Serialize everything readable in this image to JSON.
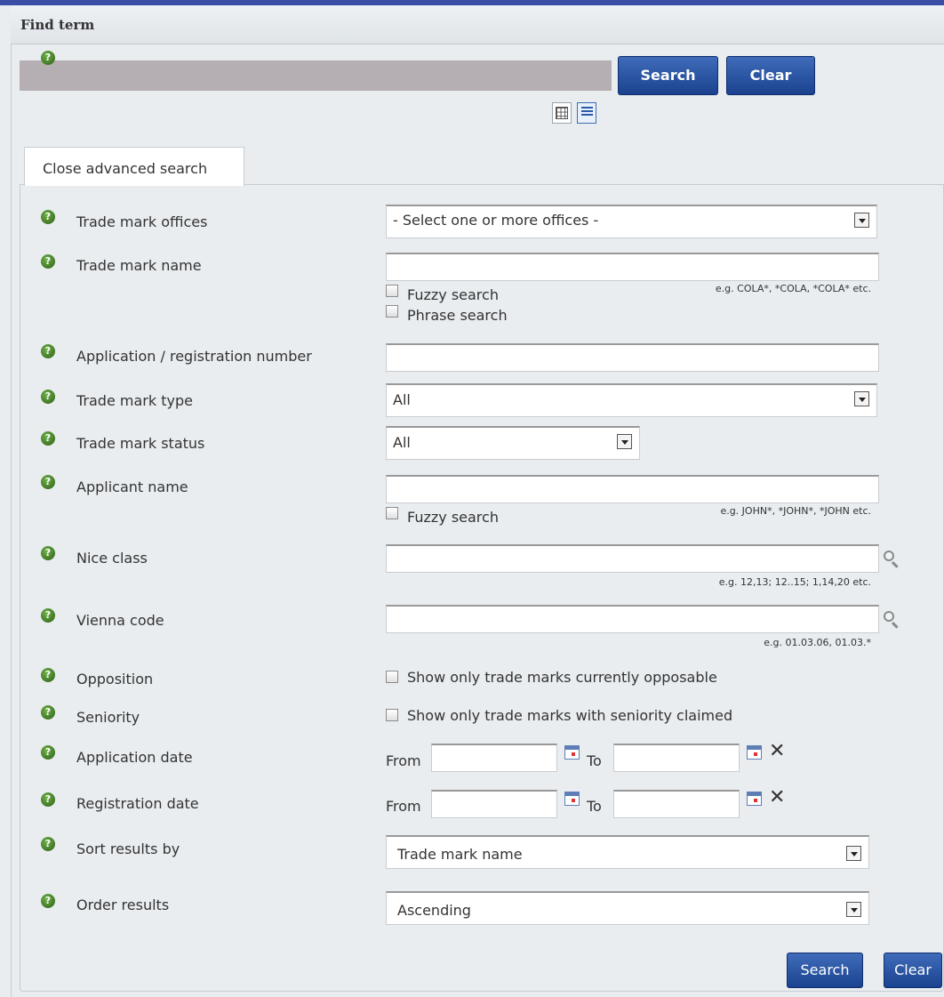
{
  "header": {
    "title": "Find term"
  },
  "quick_search": {
    "input_value": "",
    "search_label": "Search",
    "clear_label": "Clear",
    "help_icon": "help-icon"
  },
  "view_toggle": {
    "items": [
      "grid-view-icon",
      "list-view-icon"
    ],
    "active": "list-view-icon"
  },
  "advanced": {
    "tab_label": "Close advanced search",
    "fields": {
      "offices": {
        "label": "Trade mark offices",
        "value": "- Select one or more offices -"
      },
      "name": {
        "label": "Trade mark name",
        "value": "",
        "hint": "e.g. COLA*, *COLA, *COLA* etc.",
        "fuzzy": "Fuzzy search",
        "phrase": "Phrase search"
      },
      "appnum": {
        "label": "Application / registration number",
        "value": ""
      },
      "type": {
        "label": "Trade mark type",
        "value": "All"
      },
      "status": {
        "label": "Trade mark status",
        "value": "All"
      },
      "applicant": {
        "label": "Applicant name",
        "value": "",
        "hint": "e.g. JOHN*, *JOHN*, *JOHN etc.",
        "fuzzy": "Fuzzy search"
      },
      "nice": {
        "label": "Nice class",
        "value": "",
        "hint": "e.g. 12,13; 12..15; 1,14,20 etc."
      },
      "vienna": {
        "label": "Vienna code",
        "value": "",
        "hint": "e.g. 01.03.06, 01.03.*"
      },
      "opposition": {
        "label": "Opposition",
        "checkbox": "Show only trade marks currently opposable"
      },
      "seniority": {
        "label": "Seniority",
        "checkbox": "Show only trade marks with seniority claimed"
      },
      "app_date": {
        "label": "Application date",
        "from": "From",
        "to": "To"
      },
      "reg_date": {
        "label": "Registration date",
        "from": "From",
        "to": "To"
      },
      "sort": {
        "label": "Sort results by",
        "value": "Trade mark name"
      },
      "order": {
        "label": "Order results",
        "value": "Ascending"
      }
    },
    "search_label": "Search",
    "clear_label": "Clear"
  },
  "colors": {
    "topbar": "#3a4ea6",
    "button": "#1a428f",
    "background": "#e9edf0"
  }
}
